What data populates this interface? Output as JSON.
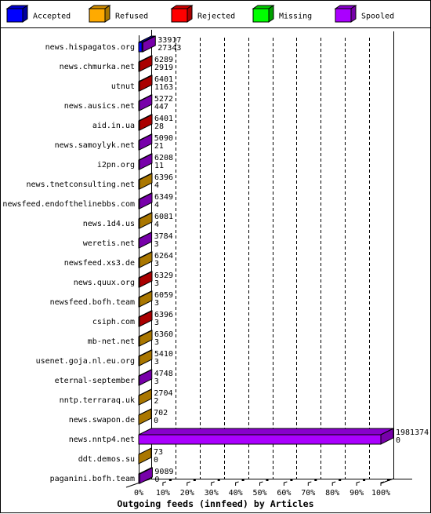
{
  "chart_data": {
    "type": "bar",
    "orientation": "horizontal",
    "style": "3d-stacked",
    "title": "Outgoing feeds (innfeed) by Articles",
    "xlabel": "Outgoing feeds (innfeed) by Articles",
    "ylabel": "",
    "xlim": [
      0,
      100
    ],
    "x_unit": "percent of largest feed",
    "scale_max": 1981374,
    "grid": true,
    "legend_position": "top",
    "x_tick_labels": [
      "0%",
      "10%",
      "20%",
      "30%",
      "40%",
      "50%",
      "60%",
      "70%",
      "80%",
      "90%",
      "100%"
    ],
    "legend": [
      {
        "name": "Accepted",
        "label": "Accepted",
        "face": "#0000ff",
        "top": "#0000cc",
        "side": "#0000a0"
      },
      {
        "name": "Refused",
        "label": "Refused",
        "face": "#ffaa00",
        "top": "#d08c00",
        "side": "#aa7700"
      },
      {
        "name": "Rejected",
        "label": "Rejected",
        "face": "#ff0000",
        "top": "#cc0000",
        "side": "#aa0000"
      },
      {
        "name": "Missing",
        "label": "Missing",
        "face": "#00ff00",
        "top": "#00cc00",
        "side": "#00a000"
      },
      {
        "name": "Spooled",
        "label": "Spooled",
        "face": "#aa00ff",
        "top": "#8800cc",
        "side": "#7700aa"
      }
    ],
    "rows": [
      {
        "host": "news.hispagatos.org",
        "total": "33917",
        "accepted": "27343",
        "main_series": "Spooled"
      },
      {
        "host": "news.chmurka.net",
        "total": "6289",
        "accepted": "2919",
        "main_series": "Rejected"
      },
      {
        "host": "utnut",
        "total": "6401",
        "accepted": "1163",
        "main_series": "Rejected"
      },
      {
        "host": "news.ausics.net",
        "total": "5272",
        "accepted": "447",
        "main_series": "Spooled"
      },
      {
        "host": "aid.in.ua",
        "total": "6401",
        "accepted": "28",
        "main_series": "Rejected"
      },
      {
        "host": "news.samoylyk.net",
        "total": "5090",
        "accepted": "21",
        "main_series": "Spooled"
      },
      {
        "host": "i2pn.org",
        "total": "6208",
        "accepted": "11",
        "main_series": "Spooled"
      },
      {
        "host": "news.tnetconsulting.net",
        "total": "6396",
        "accepted": "4",
        "main_series": "Refused"
      },
      {
        "host": "newsfeed.endofthelinebbs.com",
        "total": "6349",
        "accepted": "4",
        "main_series": "Spooled"
      },
      {
        "host": "news.1d4.us",
        "total": "6081",
        "accepted": "4",
        "main_series": "Refused"
      },
      {
        "host": "weretis.net",
        "total": "3784",
        "accepted": "3",
        "main_series": "Spooled"
      },
      {
        "host": "newsfeed.xs3.de",
        "total": "6264",
        "accepted": "3",
        "main_series": "Refused"
      },
      {
        "host": "news.quux.org",
        "total": "6329",
        "accepted": "3",
        "main_series": "Rejected"
      },
      {
        "host": "newsfeed.bofh.team",
        "total": "6059",
        "accepted": "3",
        "main_series": "Refused"
      },
      {
        "host": "csiph.com",
        "total": "6396",
        "accepted": "3",
        "main_series": "Rejected"
      },
      {
        "host": "mb-net.net",
        "total": "6360",
        "accepted": "3",
        "main_series": "Refused"
      },
      {
        "host": "usenet.goja.nl.eu.org",
        "total": "5410",
        "accepted": "3",
        "main_series": "Refused"
      },
      {
        "host": "eternal-september",
        "total": "4748",
        "accepted": "3",
        "main_series": "Spooled"
      },
      {
        "host": "nntp.terraraq.uk",
        "total": "2704",
        "accepted": "2",
        "main_series": "Refused"
      },
      {
        "host": "news.swapon.de",
        "total": "702",
        "accepted": "0",
        "main_series": "Refused"
      },
      {
        "host": "news.nntp4.net",
        "total": "1981374",
        "accepted": "0",
        "main_series": "Spooled"
      },
      {
        "host": "ddt.demos.su",
        "total": "73",
        "accepted": "0",
        "main_series": "Refused"
      },
      {
        "host": "paganini.bofh.team",
        "total": "9089",
        "accepted": "0",
        "main_series": "Spooled"
      }
    ]
  }
}
